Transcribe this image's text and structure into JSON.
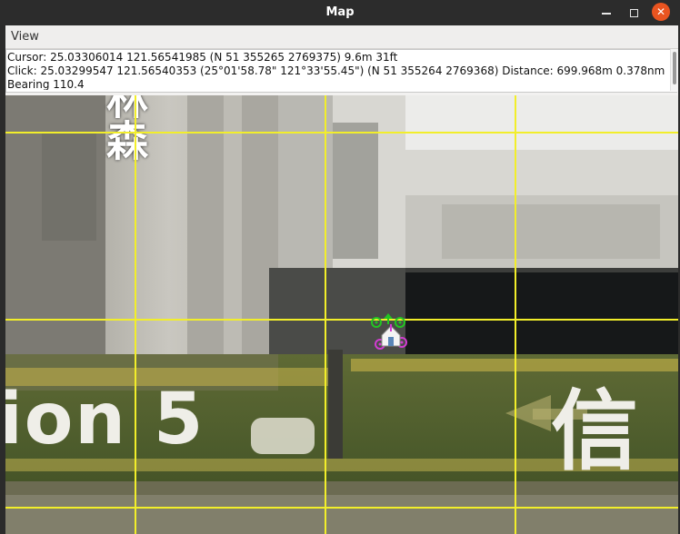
{
  "window": {
    "title": "Map"
  },
  "menu": {
    "items": [
      "View"
    ]
  },
  "info": {
    "cursor_line": "Cursor: 25.03306014 121.56541985 (N 51 355265 2769375) 9.6m 31ft",
    "click_line": "Click: 25.03299547 121.56540353 (25°01'58.78\" 121°33'55.45\") (N 51 355264 2769368)  Distance: 699.968m 0.378nm",
    "bearing_line": "Bearing 110.4"
  },
  "map": {
    "sign_text_left": "ion 5",
    "sign_text_right": "信",
    "vertical_text": "林森"
  },
  "colors": {
    "grid": "#f2ee2a",
    "titlebar": "#2c2c2c",
    "close_button": "#e95420",
    "marker_green": "#22c522",
    "marker_magenta": "#d23cd2"
  },
  "icons": {
    "minimize": "minimize-icon",
    "maximize": "maximize-icon",
    "close": "close-icon",
    "marker": "home-marker-icon"
  }
}
